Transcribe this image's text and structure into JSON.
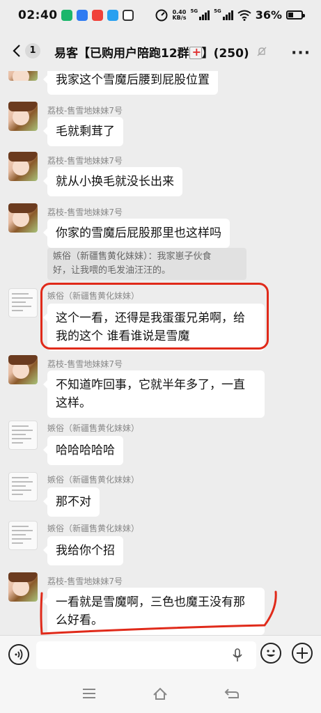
{
  "status": {
    "time": "02:40",
    "speed_value": "0.40",
    "speed_unit": "KB/s",
    "net1": "5G",
    "net2": "5G",
    "battery": "36%"
  },
  "header": {
    "back_count": "1",
    "title": "易客【已购用户陪跑12群",
    "title_suffix": "】(250)"
  },
  "messages": [
    {
      "sender": "",
      "text": "我家这个雪魔后腰到屁股位置"
    },
    {
      "sender": "荔枝-售雪地妹妹7号",
      "text": "毛就剩茸了"
    },
    {
      "sender": "荔枝-售雪地妹妹7号",
      "text": "就从小换毛就没长出来"
    },
    {
      "sender": "荔枝-售雪地妹妹7号",
      "text": "你家的雪魔后屁股那里也这样吗",
      "quote_line1": "嫉俗（新疆售黄化妹妹）：我家崽子伙食",
      "quote_line2": "好，让我喂的毛发油汪汪的。"
    },
    {
      "sender": "嫉俗（新疆售黄化妹妹）",
      "text_line1": "这个一看，还得是我蛋蛋兄弟啊，给",
      "text_line2": "我的这个 谁看谁说是雪魔"
    },
    {
      "sender": "荔枝-售雪地妹妹7号",
      "text_line1": "不知道咋回事，它就半年多了，一直",
      "text_line2": "这样。"
    },
    {
      "sender": "嫉俗（新疆售黄化妹妹）",
      "text": "哈哈哈哈哈"
    },
    {
      "sender": "嫉俗（新疆售黄化妹妹）",
      "text": "那不对"
    },
    {
      "sender": "嫉俗（新疆售黄化妹妹）",
      "text": "我给你个招"
    },
    {
      "sender": "荔枝-售雪地妹妹7号",
      "text_line1": "一看就是雪魔啊，三色也魔王没有那",
      "text_line2": "么好看。"
    }
  ],
  "colors": {
    "annotation": "#e02a1a",
    "background": "#ededed",
    "bubble": "#ffffff"
  },
  "icons": [
    "back-icon",
    "mute-icon",
    "more-icon",
    "voice-icon",
    "mic-icon",
    "emoji-icon",
    "plus-icon",
    "menu-icon",
    "home-icon",
    "back-nav-icon"
  ]
}
